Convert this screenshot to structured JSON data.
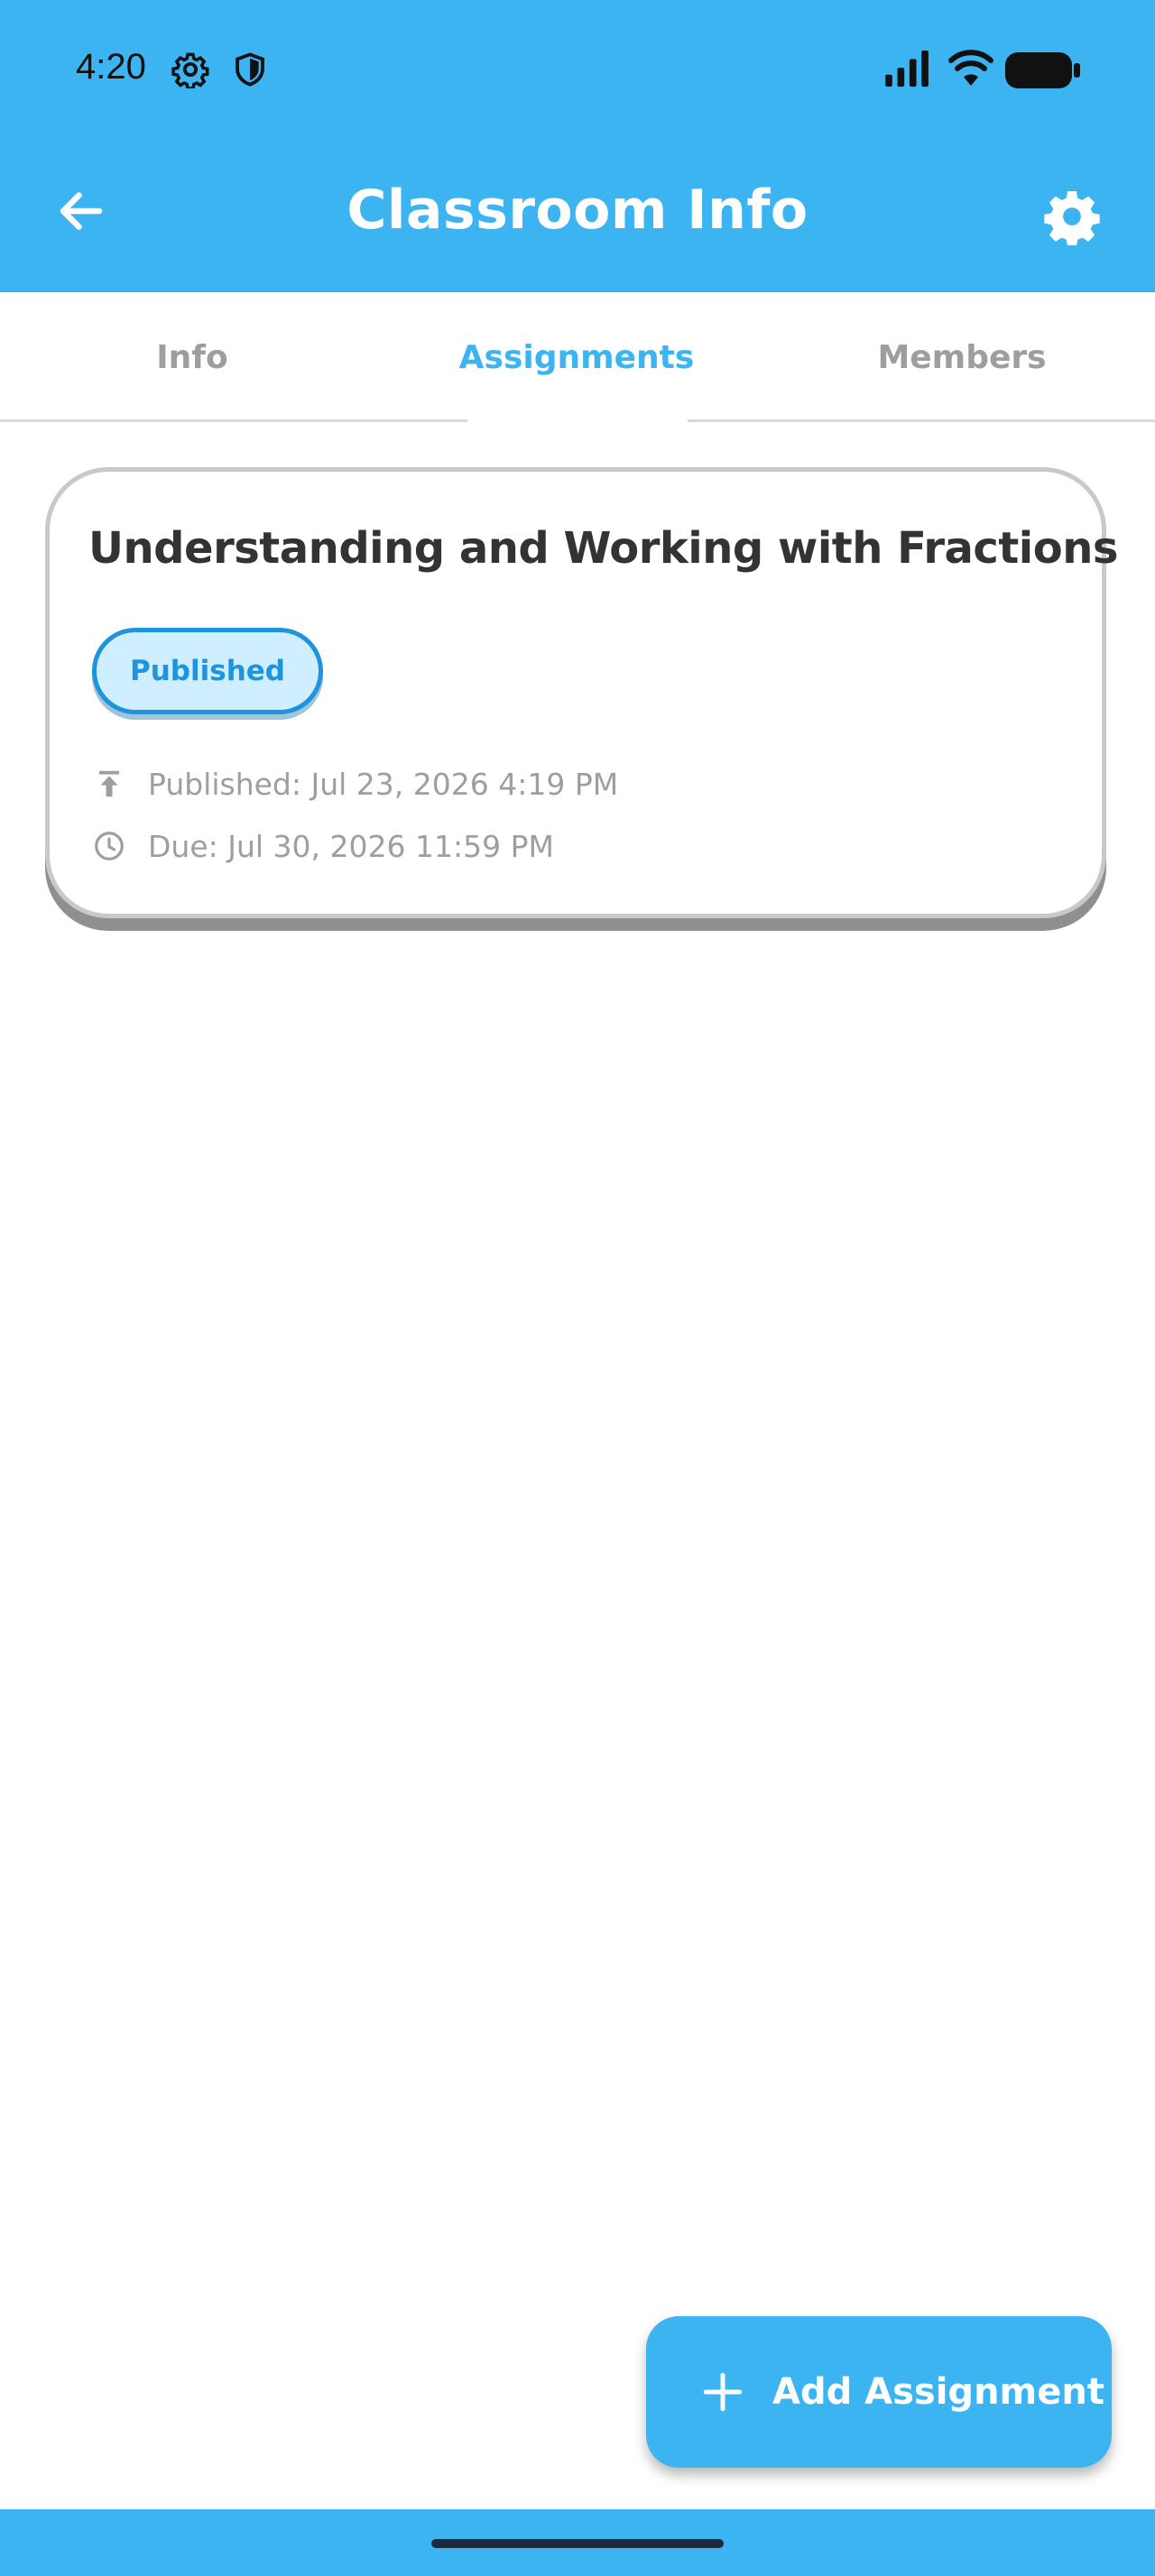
{
  "status_bar": {
    "time": "4:20",
    "icons": [
      "gear-icon",
      "shield-icon",
      "signal-icon",
      "wifi-icon",
      "battery-icon"
    ]
  },
  "header": {
    "title": "Classroom Info",
    "back_icon": "arrow-left-icon",
    "settings_icon": "gear-icon"
  },
  "tabs": [
    {
      "label": "Info",
      "active": false
    },
    {
      "label": "Assignments",
      "active": true
    },
    {
      "label": "Members",
      "active": false
    }
  ],
  "assignments": [
    {
      "title": "Understanding and Working with Fractions",
      "status": "Published",
      "published": "Published: Jul 23, 2026 4:19 PM",
      "due": "Due: Jul 30, 2026 11:59 PM"
    }
  ],
  "fab": {
    "label": "Add Assignment",
    "icon": "plus-icon"
  },
  "colors": {
    "primary": "#3db4f2",
    "badge_text": "#1e93de",
    "badge_bg": "#cfeeff",
    "muted_text": "#9e9e9e",
    "title_text": "#333333"
  }
}
